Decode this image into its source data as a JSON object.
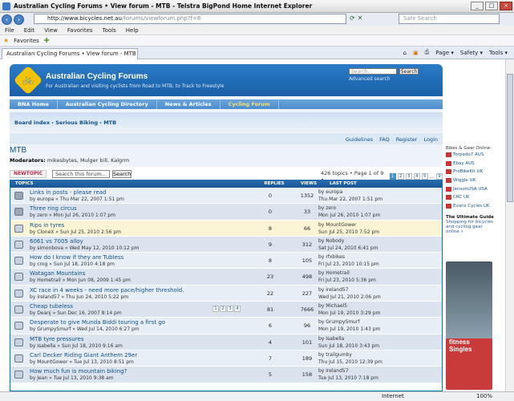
{
  "window": {
    "title": "Australian Cycling Forums • View forum - MTB - Telstra BigPond Home Internet Explorer"
  },
  "browser": {
    "url_host": "http://www.bicycles.net.au",
    "url_path": "/forums/viewforum.php?f=8",
    "search_placeholder": "Safe Search",
    "menu": [
      "File",
      "Edit",
      "View",
      "Favorites",
      "Tools",
      "Help"
    ],
    "favorites_label": "Favorites",
    "tab_title": "Australian Cycling Forums • View forum - MTB",
    "tools": [
      "Page ▾",
      "Safety ▾",
      "Tools ▾"
    ],
    "status_zone": "Internet",
    "zoom": "100%"
  },
  "forum": {
    "site_name": "Australian Cycling Forums",
    "site_desc": "For Australian and visiting cyclists from Road to MTB, to Track to Freestyle",
    "search_placeholder": "Search...",
    "search_button": "Search",
    "advanced_search": "Advanced search",
    "nav": [
      "BNA Home",
      "Australian Cycling Directory",
      "News & Articles",
      "Cycling Forum"
    ],
    "breadcrumb": "Board index ‹ Serious Biking ‹ MTB",
    "user_links": [
      "Guidelines",
      "FAQ",
      "Register",
      "Login"
    ],
    "title": "MTB",
    "moderators_label": "Moderators:",
    "moderators": "mikesbytes, Mulger bill, Kalgrm",
    "new_topic": "NEWTOPIC",
    "search_forum": "Search this forum...",
    "search_btn": "Search",
    "page_info": "426 topics • Page 1 of 9 •",
    "pages": [
      "1",
      "2",
      "3",
      "4",
      "5",
      "...",
      "9"
    ],
    "columns": {
      "topics": "TOPICS",
      "replies": "REPLIES",
      "views": "VIEWS",
      "last": "LAST POST"
    },
    "topics": [
      {
        "title": "Links in posts - please read",
        "by": "by europa » Thu Mar 22, 2007 1:51 pm",
        "replies": "0",
        "views": "1352",
        "last1": "by europa",
        "last2": "Thu Mar 22, 2007 1:51 pm",
        "kind": "locked"
      },
      {
        "title": "Three ring circus",
        "by": "by zero » Mon Jul 26, 2010 1:07 pm",
        "replies": "0",
        "views": "33",
        "last1": "by zero",
        "last2": "Mon Jul 26, 2010 1:07 pm",
        "kind": "locked"
      },
      {
        "title": "Rips in tyres",
        "by": "by CloneX » Sun Jul 25, 2010 2:56 pm",
        "replies": "8",
        "views": "66",
        "last1": "by MountGower",
        "last2": "Sun Jul 25, 2010 7:52 pm",
        "kind": "sticky"
      },
      {
        "title": "6061 vs 7005 alloy",
        "by": "by simonbova » Wed May 12, 2010 10:12 pm",
        "replies": "9",
        "views": "312",
        "last1": "by Nobody",
        "last2": "Sat Jul 24, 2010 6:41 pm",
        "kind": "normal"
      },
      {
        "title": "How do I know if they are Tubless",
        "by": "by crog » Sun Jul 18, 2010 4:18 pm",
        "replies": "8",
        "views": "105",
        "last1": "by rfxbikes",
        "last2": "Fri Jul 23, 2010 10:15 pm",
        "kind": "normal"
      },
      {
        "title": "Watagan Mountains",
        "by": "by Hometrail » Mon Jun 08, 2009 1:45 pm",
        "replies": "23",
        "views": "498",
        "last1": "by Hometrail",
        "last2": "Fri Jul 23, 2010 5:36 pm",
        "kind": "normal"
      },
      {
        "title": "XC race in 4 weeks - need more pace/higher threshold.",
        "by": "by ireland57 » Thu Jun 24, 2010 5:22 pm",
        "replies": "22",
        "views": "227",
        "last1": "by ireland57",
        "last2": "Wed Jul 21, 2010 2:06 pm",
        "kind": "normal"
      },
      {
        "title": "Cheap tubeless",
        "by": "by Deanj » Sun Dec 16, 2007 8:14 pm",
        "replies": "81",
        "views": "7666",
        "last1": "by Michael5",
        "last2": "Mon Jul 19, 2010 3:29 pm",
        "kind": "normal",
        "pages": [
          "1",
          "2",
          "3",
          "4"
        ]
      },
      {
        "title": "Desperate to give Munda Biddi touring a first go",
        "by": "by GrumpySmurf » Wed Jul 14, 2010 6:27 pm",
        "replies": "6",
        "views": "96",
        "last1": "by GrumpySmurf",
        "last2": "Mon Jul 19, 2010 1:43 pm",
        "kind": "normal"
      },
      {
        "title": "MTB tyre pressures",
        "by": "by Isabella » Sun Jul 18, 2010 9:16 am",
        "replies": "4",
        "views": "101",
        "last1": "by Isabella",
        "last2": "Sun Jul 18, 2010 3:43 pm",
        "kind": "normal"
      },
      {
        "title": "Carl Decker Riding Giant Anthem 29er",
        "by": "by MountGower » Tue Jul 13, 2010 8:51 pm",
        "replies": "7",
        "views": "189",
        "last1": "by trailgumby",
        "last2": "Thu Jul 15, 2010 12:39 pm",
        "kind": "normal"
      },
      {
        "title": "How much fun is mountain biking?",
        "by": "by Jean » Tue Jul 13, 2010 9:38 am",
        "replies": "5",
        "views": "158",
        "last1": "by ireland57",
        "last2": "Tue Jul 13, 2010 7:18 pm",
        "kind": "normal"
      }
    ],
    "sidebar": {
      "title": "Bikes & Gear Online:",
      "links": [
        "Torpedo7 AUS",
        "Ebay AUS",
        "ProBikeKit UK",
        "Wiggle UK",
        "JensonUSA USA",
        "CRC UK",
        "Evans Cycles UK"
      ],
      "ad_title": "The Ultimate Guide",
      "ad_text": "Shopping for bicycles and cycling gear online »",
      "ad_brand": "fitness Singles"
    }
  }
}
